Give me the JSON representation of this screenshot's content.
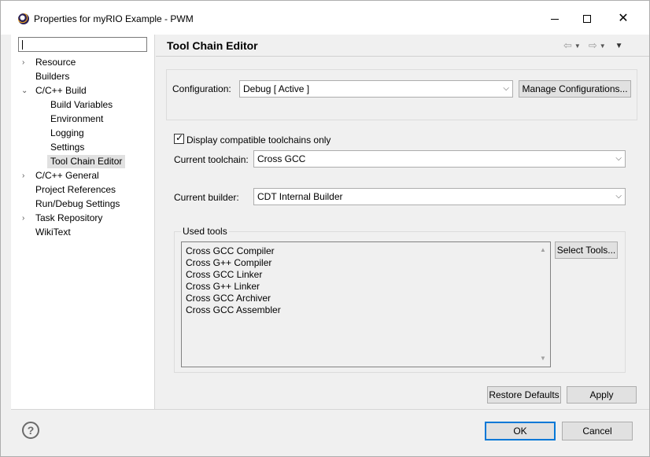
{
  "window": {
    "title": "Properties for myRIO Example - PWM",
    "icon": "eclipse-icon",
    "controls": {
      "minimize": "minimize-icon",
      "maximize": "maximize-icon",
      "close": "✕"
    }
  },
  "sidebar": {
    "filter_value": "",
    "items": [
      {
        "label": "Resource",
        "expander": "›"
      },
      {
        "label": "Builders"
      },
      {
        "label": "C/C++ Build",
        "expander": "⌄"
      },
      {
        "label": "Build Variables"
      },
      {
        "label": "Environment"
      },
      {
        "label": "Logging"
      },
      {
        "label": "Settings"
      },
      {
        "label": "Tool Chain Editor",
        "selected": true
      },
      {
        "label": "C/C++ General",
        "expander": "›"
      },
      {
        "label": "Project References"
      },
      {
        "label": "Run/Debug Settings"
      },
      {
        "label": "Task Repository",
        "expander": "›"
      },
      {
        "label": "WikiText"
      }
    ]
  },
  "page": {
    "title": "Tool Chain Editor",
    "nav": {
      "back": "⇦",
      "forward": "⇨",
      "dropdown": "▼",
      "menu": "▼"
    }
  },
  "configuration": {
    "label": "Configuration:",
    "value": "Debug  [ Active ]",
    "manage_button": "Manage Configurations..."
  },
  "toolchain": {
    "checkbox_label": "Display compatible toolchains only",
    "checkbox_checked": true,
    "current_toolchain_label": "Current toolchain:",
    "current_toolchain_value": "Cross GCC",
    "current_builder_label": "Current builder:",
    "current_builder_value": "CDT Internal Builder"
  },
  "used_tools": {
    "legend": "Used tools",
    "tools": [
      "Cross GCC Compiler",
      "Cross G++ Compiler",
      "Cross GCC Linker",
      "Cross G++ Linker",
      "Cross GCC Archiver",
      "Cross GCC Assembler"
    ],
    "select_button": "Select Tools..."
  },
  "footer": {
    "restore_defaults": "Restore Defaults",
    "apply": "Apply",
    "ok": "OK",
    "cancel": "Cancel",
    "help_icon": "?"
  },
  "colors": {
    "selection": "#e1e1e1",
    "default_button_border": "#0078d7",
    "background": "#f0f0f0"
  }
}
